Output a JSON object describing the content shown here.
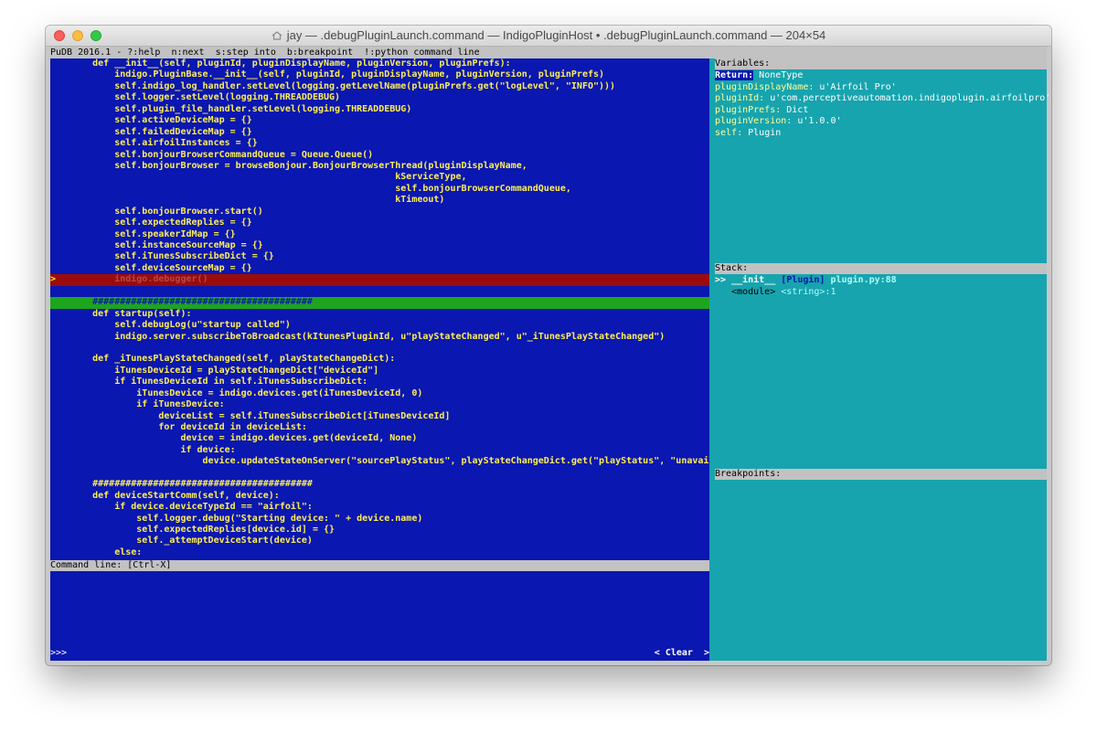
{
  "window": {
    "title": "jay — .debugPluginLaunch.command — IndigoPluginHost • .debugPluginLaunch.command — 204×54"
  },
  "pudb": {
    "header": "PuDB 2016.1 - ?:help  n:next  s:step into  b:breakpoint  !:python command line",
    "command_line_label": "Command line: [Ctrl-X]",
    "prompt": ">>>",
    "clear_button": "< Clear  >"
  },
  "code": {
    "lines": [
      "def __init__(self, pluginId, pluginDisplayName, pluginVersion, pluginPrefs):",
      "    indigo.PluginBase.__init__(self, pluginId, pluginDisplayName, pluginVersion, pluginPrefs)",
      "    self.indigo_log_handler.setLevel(logging.getLevelName(pluginPrefs.get(\"logLevel\", \"INFO\")))",
      "    self.logger.setLevel(logging.THREADDEBUG)",
      "    self.plugin_file_handler.setLevel(logging.THREADDEBUG)",
      "    self.activeDeviceMap = {}",
      "    self.failedDeviceMap = {}",
      "    self.airfoilInstances = {}",
      "    self.bonjourBrowserCommandQueue = Queue.Queue()",
      "    self.bonjourBrowser = browseBonjour.BonjourBrowserThread(pluginDisplayName,",
      "                                                       kServiceType,",
      "                                                       self.bonjourBrowserCommandQueue,",
      "                                                       kTimeout)",
      "    self.bonjourBrowser.start()",
      "    self.expectedReplies = {}",
      "    self.speakerIdMap = {}",
      "    self.instanceSourceMap = {}",
      "    self.iTunesSubscribeDict = {}",
      "    self.deviceSourceMap = {}",
      "    indigo.debugger()",
      "",
      "########################################",
      "def startup(self):",
      "    self.debugLog(u\"startup called\")",
      "    indigo.server.subscribeToBroadcast(kItunesPluginId, u\"playStateChanged\", u\"_iTunesPlayStateChanged\")",
      "",
      "def _iTunesPlayStateChanged(self, playStateChangeDict):",
      "    iTunesDeviceId = playStateChangeDict[\"deviceId\"]",
      "    if iTunesDeviceId in self.iTunesSubscribeDict:",
      "        iTunesDevice = indigo.devices.get(iTunesDeviceId, 0)",
      "        if iTunesDevice:",
      "            deviceList = self.iTunesSubscribeDict[iTunesDeviceId]",
      "            for deviceId in deviceList:",
      "                device = indigo.devices.get(deviceId, None)",
      "                if device:",
      "                    device.updateStateOnServer(\"sourcePlayStatus\", playStateChangeDict.get(\"playStatus\", \"unavailable\"))",
      "",
      "########################################",
      "def deviceStartComm(self, device):",
      "    if device.deviceTypeId == \"airfoil\":",
      "        self.logger.debug(\"Starting device: \" + device.name)",
      "        self.expectedReplies[device.id] = {}",
      "        self._attemptDeviceStart(device)",
      "    else:"
    ],
    "current_line_marker": ">"
  },
  "variables": {
    "header": "Variables:",
    "items": [
      {
        "name": "Return:",
        "value": " NoneType"
      },
      {
        "name": "pluginDisplayName:",
        "value": " u'Airfoil Pro'"
      },
      {
        "name": "pluginId:",
        "value": " u'com.perceptiveautomation.indigoplugin.airfoilpro'"
      },
      {
        "name": "pluginPrefs:",
        "value": " Dict"
      },
      {
        "name": "pluginVersion:",
        "value": " u'1.0.0'"
      },
      {
        "name": "self:",
        "value": " Plugin"
      }
    ]
  },
  "stack": {
    "header": "Stack:",
    "items": [
      {
        "marker": ">> ",
        "func": "__init__",
        "cls": " [Plugin]",
        "loc": " plugin.py:88"
      },
      {
        "marker": "   ",
        "func": "<module>",
        "cls": "",
        "loc": " <string>:1"
      }
    ]
  },
  "breakpoints": {
    "header": "Breakpoints:"
  }
}
